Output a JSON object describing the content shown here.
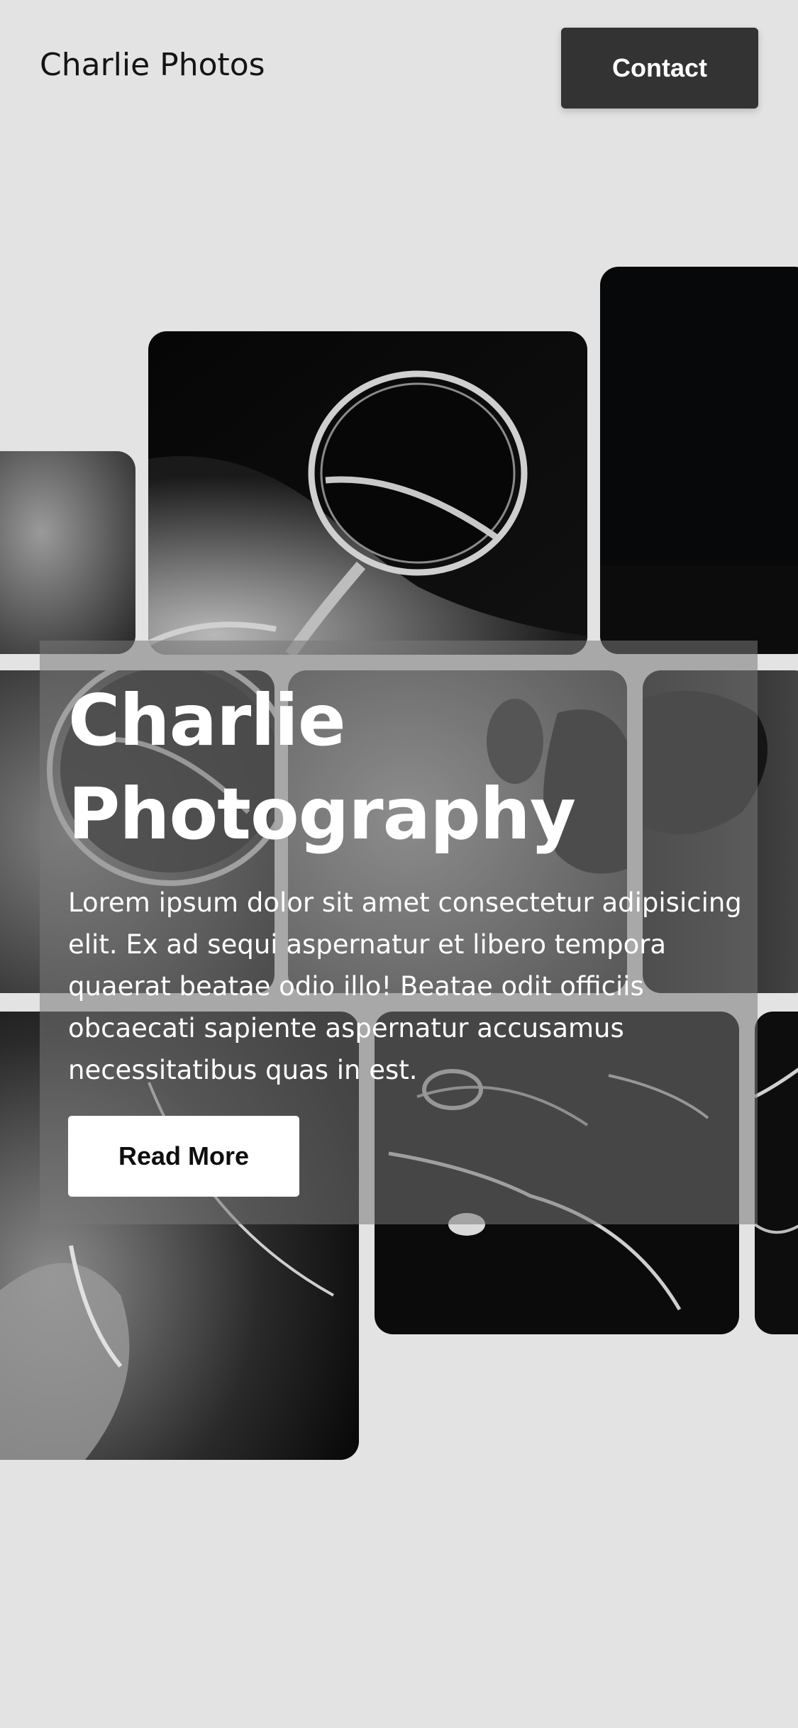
{
  "header": {
    "brand": "Charlie Photos",
    "contact_label": "Contact"
  },
  "hero": {
    "title_line1": "Charlie",
    "title_line2": "Photography",
    "description": "Lorem ipsum dolor sit amet consectetur adipisicing elit. Ex ad sequi aspernatur et libero tempora quaerat beatae odio illo! Beatae odit officiis obcaecati sapiente aspernatur accusamus necessitatibus quas in est.",
    "read_more_label": "Read More"
  },
  "colors": {
    "background": "#e3e3e3",
    "contact_button": "#333333",
    "read_more_button": "#ffffff",
    "overlay": "#787878"
  }
}
